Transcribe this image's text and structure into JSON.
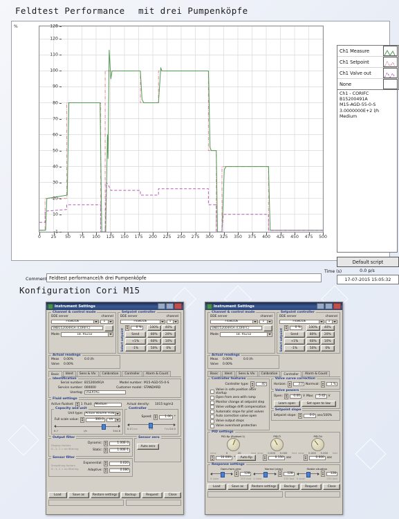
{
  "headings": {
    "title_left": "Feldtest Performance",
    "title_right": "mit drei Pumpenköpfe",
    "config_title": "Konfiguration Cori M15"
  },
  "chart_panel": {
    "percent_label": "%",
    "time_axis_label": "Time (s)",
    "comment_label": "Comment",
    "comment_value": "Feldtest performancel/h drei Pumpenköpfe",
    "timestamp": "17-07-2015  15:05:32",
    "points_rate": "0.0 p/s",
    "default_script_button": "Default script",
    "legend": [
      {
        "label": "Ch1 Measure",
        "color": "#4f9a4f",
        "style": "solid"
      },
      {
        "label": "Ch1 Setpoint",
        "color": "#d98a9a",
        "style": "dashdot"
      },
      {
        "label": "Ch1 Valve out",
        "color": "#b45fb4",
        "style": "dashed"
      },
      {
        "label": "None",
        "color": "#ffffff",
        "style": "none"
      }
    ],
    "info_lines": [
      "Ch1 - CORIFC",
      "B15200491A",
      "M15-AGD-55-0-S",
      "3.0000000E+2 l/h",
      "Medium"
    ]
  },
  "chart_data": {
    "type": "line",
    "title": "Feldtest Performance",
    "xlabel": "Time (s)",
    "ylabel": "%",
    "xlim": [
      0,
      500
    ],
    "ylim": [
      -1,
      128
    ],
    "xticks": [
      0,
      25,
      50,
      75,
      100,
      125,
      150,
      175,
      200,
      225,
      250,
      275,
      300,
      325,
      350,
      375,
      400,
      425,
      450,
      475,
      500
    ],
    "yticks": [
      -1,
      10,
      20,
      30,
      40,
      50,
      60,
      70,
      80,
      90,
      100,
      110,
      120,
      128
    ],
    "grid": true,
    "legend_position": "right-outside",
    "series": [
      {
        "name": "Ch1 Setpoint",
        "color": "#d98a9a",
        "style": "dashdot",
        "points": [
          [
            0,
            0
          ],
          [
            10,
            0
          ],
          [
            10,
            20
          ],
          [
            48,
            20
          ],
          [
            48,
            80
          ],
          [
            108,
            80
          ],
          [
            108,
            -1
          ],
          [
            116,
            -1
          ],
          [
            116,
            100
          ],
          [
            178,
            100
          ],
          [
            178,
            80
          ],
          [
            210,
            80
          ],
          [
            210,
            100
          ],
          [
            298,
            100
          ],
          [
            298,
            50
          ],
          [
            312,
            50
          ],
          [
            312,
            -1
          ],
          [
            322,
            -1
          ],
          [
            322,
            40
          ],
          [
            404,
            40
          ],
          [
            404,
            0
          ],
          [
            500,
            0
          ]
        ]
      },
      {
        "name": "Ch1 Measure",
        "color": "#4f9a4f",
        "style": "solid",
        "points": [
          [
            0,
            0
          ],
          [
            11,
            0
          ],
          [
            13,
            20
          ],
          [
            49,
            22
          ],
          [
            52,
            80
          ],
          [
            54,
            80
          ],
          [
            107,
            80
          ],
          [
            110,
            -1
          ],
          [
            117,
            -1
          ],
          [
            120,
            60
          ],
          [
            121,
            45
          ],
          [
            123,
            113
          ],
          [
            126,
            95
          ],
          [
            128,
            100
          ],
          [
            178,
            100
          ],
          [
            181,
            82
          ],
          [
            184,
            80
          ],
          [
            210,
            80
          ],
          [
            214,
            102
          ],
          [
            216,
            100
          ],
          [
            298,
            100
          ],
          [
            301,
            52
          ],
          [
            303,
            50
          ],
          [
            312,
            50
          ],
          [
            314,
            -1
          ],
          [
            322,
            -1
          ],
          [
            326,
            38
          ],
          [
            329,
            40
          ],
          [
            404,
            40
          ],
          [
            407,
            0
          ],
          [
            500,
            0
          ]
        ]
      },
      {
        "name": "Ch1 Valve out",
        "color": "#b45fb4",
        "style": "dashed",
        "points": [
          [
            0,
            5
          ],
          [
            10,
            5
          ],
          [
            10,
            12
          ],
          [
            48,
            13
          ],
          [
            48,
            16
          ],
          [
            108,
            16
          ],
          [
            108,
            -1
          ],
          [
            116,
            -1
          ],
          [
            118,
            30
          ],
          [
            122,
            28
          ],
          [
            126,
            25
          ],
          [
            178,
            25
          ],
          [
            178,
            22
          ],
          [
            210,
            22
          ],
          [
            210,
            26
          ],
          [
            298,
            26
          ],
          [
            298,
            16
          ],
          [
            312,
            16
          ],
          [
            312,
            -1
          ],
          [
            322,
            -1
          ],
          [
            324,
            10
          ],
          [
            404,
            10
          ],
          [
            404,
            0
          ],
          [
            500,
            0
          ]
        ]
      }
    ]
  },
  "dialog_left": {
    "title": "Instrument Settings",
    "channel_group": {
      "legend": "Channel & control mode",
      "dde_server_label": "DDE server",
      "dde_server_value": "FlowDDE",
      "channel_label": "channel",
      "channel_value": "1",
      "sn_value": "SNB15200491A (CORIFC)",
      "mode_label": "Mode",
      "mode_value": "18. RS232"
    },
    "setpoint_group": {
      "legend": "Setpoint controller",
      "dde_server_label": "DDE server",
      "dde_server_value": "FlowDDE",
      "channel_label": "channel",
      "channel_value": "1",
      "vertical_label": "Select setpoint",
      "setpoint_value": "0 %",
      "send_button": "Send",
      "plus_button": "+1%",
      "minus_button": "-1%",
      "percent_buttons": [
        "100%",
        "40%",
        "80%",
        "20%",
        "60%",
        "10%",
        "50%",
        "0%"
      ]
    },
    "readings_group": {
      "legend": "Actual readings",
      "meas_label": "Meas",
      "meas_value": "0.00%",
      "meas_flow": "0.0 l/h",
      "valve_label": "Valve",
      "valve_value": "0.00%"
    },
    "tabs": [
      "Basic",
      "Ident",
      "Sens & Vlv",
      "Calibration",
      "Controller",
      "Alarm & Count"
    ],
    "active_tab": "Basic",
    "identification": {
      "legend": "Identification",
      "serial_label": "Serial number:",
      "serial_value": "B15200491A",
      "model_label": "Model number:",
      "model_value": "M15-AGD-55-0-S",
      "service_label": "Service number:",
      "service_value": "000000",
      "customer_label": "Customer model:",
      "customer_value": "STANDARD",
      "usertag_label": "Usertag:",
      "usertag_value": "USERTAG"
    },
    "fluid": {
      "legend": "Fluid settings",
      "active_label": "Active fluidset:",
      "active_value": "1",
      "fluid_label": "Fluid:",
      "fluid_value": "Medium",
      "density_label": "Actual density:",
      "density_value": "1015 kg/m3"
    },
    "capacity": {
      "legend": "Capacity and unit",
      "unit_type_label": "Unit type:",
      "unit_type_value": "Actual Volume Flow",
      "full_scale_label": "Full scale value:",
      "full_scale_value": "300.0",
      "unit_value": "l/h",
      "slider_min": "6.7",
      "slider_unit": "l/h",
      "slider_max": "344.8"
    },
    "controller": {
      "legend": "Controller",
      "speed_label": "Speed:",
      "speed_value": "1.00",
      "speed_suffix": "*",
      "slider_min": "0.1",
      "slider_min_tag": "Slow",
      "slider_mid": "1.0",
      "slider_max": "10.0",
      "slider_max_tag": "Fast"
    },
    "output_filter": {
      "legend": "Output filter",
      "hint1": "Display factors",
      "hint2": "0...1, 1 = no filtering",
      "dynamic_label": "Dynamic:",
      "dynamic_value": "1.00E-3",
      "static_label": "Static:",
      "static_value": "1.00E-1"
    },
    "sensor_filter": {
      "legend": "Sensor filter",
      "hint1": "Smoothing factors",
      "hint2": "0...1, 1 = no filtering",
      "exp_label": "Exponential:",
      "exp_value": "0.020",
      "adaptive_label": "Adaptive:",
      "adaptive_value": "0.080"
    },
    "sensor_zero": {
      "legend": "Sensor zero",
      "auto_zero_button": "Auto zero"
    },
    "buttons": [
      "Load",
      "Save as",
      "Restore settings",
      "Backup",
      "Request",
      "Close"
    ]
  },
  "dialog_right": {
    "title": "Instrument Settings",
    "channel_group": {
      "legend": "Channel & control mode",
      "dde_server_label": "DDE server",
      "dde_server_value": "FlowDDE",
      "channel_label": "channel",
      "channel_value": "1",
      "sn_value": "SNB15200491A (CORIFC)",
      "mode_label": "Mode",
      "mode_value": "18. RS232"
    },
    "setpoint_group": {
      "legend": "Setpoint controller",
      "dde_server_label": "DDE server",
      "dde_server_value": "FlowDDE",
      "channel_label": "channel",
      "channel_value": "1",
      "vertical_label": "Select setpoint",
      "setpoint_value": "0 %",
      "send_button": "Send",
      "plus_button": "+1%",
      "minus_button": "-1%",
      "percent_buttons": [
        "100%",
        "40%",
        "80%",
        "20%",
        "60%",
        "10%",
        "50%",
        "0%"
      ]
    },
    "readings_group": {
      "legend": "Actual readings",
      "meas_label": "Meas",
      "meas_value": "0.00%",
      "meas_flow": "0.0 l/h",
      "valve_label": "Valve",
      "valve_value": "0.00%"
    },
    "tabs": [
      "Basic",
      "Ident",
      "Sens & Vlv",
      "Calibration",
      "Controller",
      "Alarm & Count"
    ],
    "active_tab": "Controller",
    "controller_features": {
      "legend": "Controller features",
      "type_label": "Controller type:",
      "type_value": "40",
      "checkboxes": [
        "Valve in safe position after startup",
        "Open from zero with ramp",
        "Monitor change at setpoint step",
        "Valve voltage drift compensation",
        "Automatic slope for pilot valves",
        "Auto correction valve open",
        "Valve output steps",
        "Valve overshoot protection"
      ]
    },
    "valve_curve": {
      "legend": "Valve curve correction",
      "horizon_label": "Horizon:",
      "horizon_value": "3.0",
      "normval_label": "Normval:",
      "normval_value": "1 %"
    },
    "valve_powers": {
      "legend": "Valve powers",
      "open_label": "Open:",
      "open_value": "0.00",
      "open_unit": "V",
      "max_label": "Max:",
      "max_value": "5.42",
      "max_unit": "V",
      "learn_button": "Learn open",
      "set_button": "Set open to low"
    },
    "setpoint_slope": {
      "legend": "Setpoint slope",
      "label": "Setpoint slope:",
      "value": "0.0",
      "unit": "sec/100%"
    },
    "pid": {
      "legend": "PID settings",
      "knobs": [
        {
          "title": "PID-Kp (fluidset 1)",
          "min_tag": "slow",
          "max_tag": "fast",
          "min_value": "0",
          "max_value": "20",
          "scale": [
            "2",
            "4",
            "6",
            "8",
            "10",
            "12",
            "14",
            "16",
            "18"
          ],
          "field_value": "10.000",
          "field_suffix": "*",
          "button": "Auto Kp"
        },
        {
          "title": "PID-Ti",
          "min_tag": "slow",
          "max_tag": "fast",
          "min_value": "0.000",
          "max_value": "5.000",
          "scale": [
            "0.001",
            "0.030",
            "0.100",
            "1.000"
          ],
          "field_value": "0.150",
          "field_suffix": "sec",
          "button": ""
        },
        {
          "title": "PID-Td",
          "min_tag": "slow",
          "max_tag": "fast",
          "min_value": "0.000",
          "max_value": "5.000",
          "scale": [
            "0.001",
            "0.030",
            "0.100",
            "1.000"
          ],
          "field_value": "0.000",
          "field_suffix": "sec",
          "button": ""
        }
      ]
    },
    "response": {
      "legend": "Response settings",
      "items": [
        {
          "title": "Open-from-zero",
          "value": "128",
          "min_tag": "0 slow",
          "max_tag": "255 fast"
        },
        {
          "title": "Normal (step)",
          "value": "128",
          "min_tag": "0 slow",
          "max_tag": "255 fast"
        },
        {
          "title": "Stable situation",
          "value": "128",
          "min_tag": "0 slow",
          "max_tag": "255 fast"
        }
      ]
    },
    "buttons": [
      "Load",
      "Save as",
      "Restore settings",
      "Backup",
      "Request",
      "Close"
    ]
  }
}
